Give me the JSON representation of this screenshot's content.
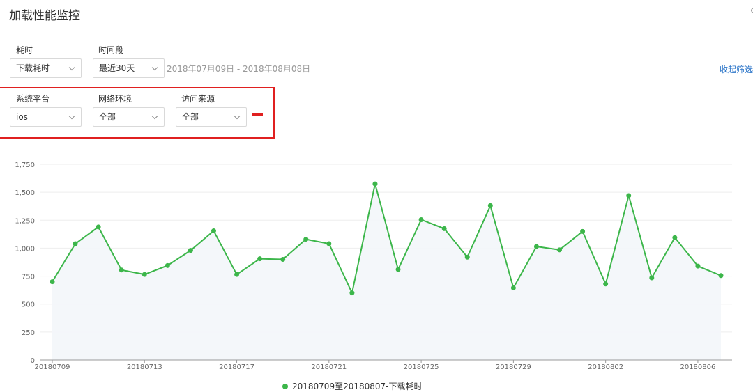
{
  "page": {
    "title": "加载性能监控"
  },
  "filters": {
    "metric": {
      "label": "耗时",
      "value": "下载耗时"
    },
    "period": {
      "label": "时间段",
      "value": "最近30天",
      "range_text": "2018年07月09日 - 2018年08月08日"
    },
    "collapse_label": "收起筛选",
    "platform": {
      "label": "系统平台",
      "value": "ios"
    },
    "network": {
      "label": "网络环境",
      "value": "全部"
    },
    "source": {
      "label": "访问来源",
      "value": "全部"
    }
  },
  "colors": {
    "series": "#3cb64a",
    "highlight": "#e02020",
    "link": "#2d76c9"
  },
  "chart_data": {
    "type": "line",
    "x": [
      "20180709",
      "20180710",
      "20180711",
      "20180712",
      "20180713",
      "20180714",
      "20180715",
      "20180716",
      "20180717",
      "20180718",
      "20180719",
      "20180720",
      "20180721",
      "20180722",
      "20180723",
      "20180724",
      "20180725",
      "20180726",
      "20180727",
      "20180728",
      "20180729",
      "20180730",
      "20180731",
      "20180801",
      "20180802",
      "20180803",
      "20180804",
      "20180805",
      "20180806",
      "20180807"
    ],
    "xtick_labels": [
      "20180709",
      "20180713",
      "20180717",
      "20180721",
      "20180725",
      "20180729",
      "20180802",
      "20180806"
    ],
    "yticks": [
      0,
      250,
      500,
      750,
      1000,
      1250,
      1500,
      1750
    ],
    "ytick_labels": [
      "0",
      "250",
      "500",
      "750",
      "1,000",
      "1,250",
      "1,500",
      "1,750"
    ],
    "ylim": [
      0,
      1750
    ],
    "grid": true,
    "legend_position": "bottom",
    "series": [
      {
        "name": "20180709至20180807-下载耗时",
        "values": [
          700,
          1040,
          1190,
          805,
          765,
          845,
          980,
          1155,
          765,
          905,
          900,
          1080,
          1040,
          600,
          1575,
          810,
          1255,
          1175,
          920,
          1380,
          645,
          1015,
          985,
          1150,
          680,
          1470,
          735,
          1095,
          840,
          755
        ]
      }
    ]
  }
}
